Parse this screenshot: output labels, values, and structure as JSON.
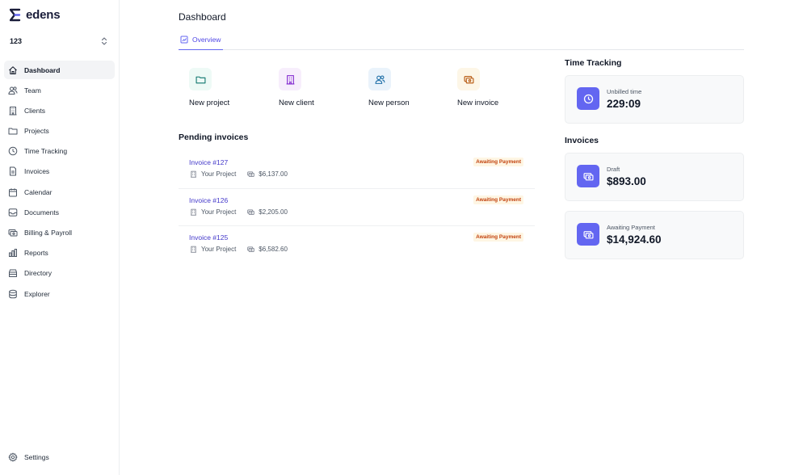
{
  "app": {
    "name": "edens",
    "workspace": "123"
  },
  "sidebar": {
    "items": [
      {
        "label": "Dashboard",
        "icon": "home-icon",
        "active": true
      },
      {
        "label": "Team",
        "icon": "users-icon"
      },
      {
        "label": "Clients",
        "icon": "building-icon"
      },
      {
        "label": "Projects",
        "icon": "folder-icon"
      },
      {
        "label": "Time Tracking",
        "icon": "clock-icon"
      },
      {
        "label": "Invoices",
        "icon": "document-icon"
      },
      {
        "label": "Calendar",
        "icon": "calendar-icon"
      },
      {
        "label": "Documents",
        "icon": "inbox-icon"
      },
      {
        "label": "Billing & Payroll",
        "icon": "cash-icon"
      },
      {
        "label": "Reports",
        "icon": "chart-bar-icon"
      },
      {
        "label": "Directory",
        "icon": "archive-icon"
      },
      {
        "label": "Explorer",
        "icon": "database-icon"
      }
    ],
    "settings_label": "Settings"
  },
  "header": {
    "title": "Dashboard",
    "tabs": [
      {
        "label": "Overview",
        "icon": "chart-square-icon"
      }
    ]
  },
  "quick_actions": [
    {
      "label": "New project",
      "icon": "folder-icon",
      "bg": "#eefaf6",
      "fg": "#0f766e"
    },
    {
      "label": "New client",
      "icon": "building-icon",
      "bg": "#f7eefc",
      "fg": "#7e22ce"
    },
    {
      "label": "New person",
      "icon": "users-icon",
      "bg": "#eaf3fb",
      "fg": "#1e6fa8"
    },
    {
      "label": "New invoice",
      "icon": "cash-icon",
      "bg": "#fdf6e7",
      "fg": "#b45309"
    }
  ],
  "pending_invoices": {
    "title": "Pending invoices",
    "items": [
      {
        "title": "Invoice #127",
        "project": "Your Project",
        "amount": "$6,137.00",
        "status": "Awaiting Payment"
      },
      {
        "title": "Invoice #126",
        "project": "Your Project",
        "amount": "$2,205.00",
        "status": "Awaiting Payment"
      },
      {
        "title": "Invoice #125",
        "project": "Your Project",
        "amount": "$6,582.60",
        "status": "Awaiting Payment"
      }
    ]
  },
  "time_tracking": {
    "title": "Time Tracking",
    "label": "Unbilled time",
    "value": "229:09"
  },
  "invoices_summary": {
    "title": "Invoices",
    "cards": [
      {
        "label": "Draft",
        "value": "$893.00"
      },
      {
        "label": "Awaiting Payment",
        "value": "$14,924.60"
      }
    ]
  },
  "colors": {
    "accent": "#6366f1",
    "badge_bg": "#fef6e4",
    "badge_text": "#c2410c",
    "link": "#4338ca"
  }
}
